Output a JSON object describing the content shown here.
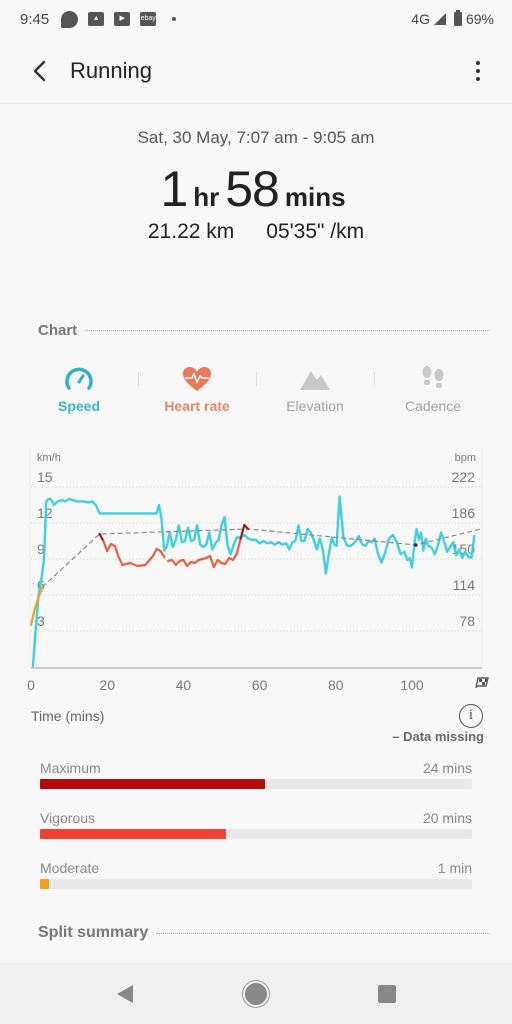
{
  "status_bar": {
    "time": "9:45",
    "notification_icons": [
      "app-notification-icon",
      "gallery-icon",
      "youtube-icon",
      "ebay-icon"
    ],
    "ebay_label": "ebay",
    "network": "4G",
    "battery": "69%"
  },
  "app_bar": {
    "title": "Running",
    "back_icon": "chevron-left-icon",
    "more_icon": "more-vertical-icon"
  },
  "summary": {
    "date_range": "Sat, 30 May, 7:07 am - 9:05 am",
    "duration_hours": "1",
    "duration_hours_unit": "hr",
    "duration_minutes": "58",
    "duration_minutes_unit": "mins",
    "distance": "21.22 km",
    "pace": "05'35\" /km"
  },
  "chart_section": {
    "title": "Chart",
    "tabs": [
      {
        "label": "Speed",
        "icon": "speedometer-icon",
        "active": true,
        "color": "#3ab5c4"
      },
      {
        "label": "Heart rate",
        "icon": "heart-rate-icon",
        "active": true,
        "color": "#e8866a"
      },
      {
        "label": "Elevation",
        "icon": "mountain-icon",
        "active": false,
        "color": "#a0a0a0"
      },
      {
        "label": "Cadence",
        "icon": "footsteps-icon",
        "active": false,
        "color": "#a0a0a0"
      }
    ]
  },
  "chart_data": {
    "type": "line",
    "title": "",
    "xlabel": "Time (mins)",
    "ylabel": "km/h",
    "y2label": "bpm",
    "xlim": [
      0,
      118
    ],
    "ylim": [
      0,
      16
    ],
    "y2lim": [
      42,
      234
    ],
    "x_ticks": [
      0,
      20,
      40,
      60,
      80,
      100
    ],
    "x_end_marker": "finish-flag-icon",
    "y_ticks": [
      3,
      6,
      9,
      12,
      15
    ],
    "y2_ticks": [
      78,
      114,
      150,
      186,
      222
    ],
    "grid": true,
    "series": [
      {
        "name": "Speed",
        "unit": "km/h",
        "color": "#3fd0dc",
        "x": [
          0.5,
          1.2,
          2,
          2.8,
          3.4,
          4,
          4.6,
          5.2,
          6,
          7,
          8,
          9,
          10,
          11,
          12,
          13,
          14,
          15,
          16,
          17,
          18,
          20,
          24,
          28,
          32,
          33,
          33.6,
          34.2,
          35,
          35.6,
          36.4,
          37.2,
          38,
          38.8,
          39.6,
          40.4,
          41.2,
          42,
          42.8,
          43.6,
          44.4,
          45.2,
          46,
          46.8,
          47.6,
          48.4,
          49.2,
          50,
          50.8,
          51.6,
          52.4,
          53.2,
          54,
          55,
          56,
          57,
          58,
          59,
          60,
          61,
          62,
          63,
          64,
          65,
          66,
          67,
          67.8,
          68.6,
          69.4,
          70.2,
          71,
          71.8,
          72.6,
          73.4,
          74.2,
          75,
          75.8,
          76.6,
          77.4,
          78.2,
          79,
          79.6,
          80.2,
          81,
          82,
          83,
          84,
          85,
          86,
          87,
          87.8,
          88.6,
          89.4,
          90.2,
          91,
          92,
          93,
          94,
          95,
          96,
          97,
          98,
          98.8,
          99.4,
          100,
          100.6,
          101.2,
          101.8,
          102.4,
          103,
          103.6,
          104.2,
          105,
          106,
          106.8,
          107.6,
          108.4,
          109.2,
          110,
          110.8,
          111.6,
          112.4,
          113.2,
          114,
          114.8,
          115.6,
          116.4,
          117.2,
          117.8
        ],
        "values": [
          0,
          3,
          6,
          7.5,
          9,
          13.8,
          14,
          14,
          13.5,
          13.8,
          13.9,
          13.8,
          14,
          13.9,
          13.8,
          13.8,
          13.8,
          13.7,
          13.8,
          13.5,
          12.8,
          12.8,
          12.8,
          12.8,
          12.8,
          12.8,
          13.5,
          12.5,
          9.7,
          10,
          11.2,
          10,
          10.6,
          11.8,
          10.4,
          10.5,
          11.6,
          10.5,
          10.6,
          11.8,
          10.2,
          10,
          10.2,
          11.2,
          9.8,
          10.3,
          10.6,
          11.8,
          12.5,
          10.1,
          9.4,
          10.2,
          10.8,
          10.8,
          11,
          10.7,
          10.6,
          10.6,
          10.3,
          10.5,
          10.3,
          10.4,
          10.2,
          10.4,
          10.2,
          10.3,
          9.8,
          10.4,
          10.5,
          11.8,
          10.5,
          10.5,
          11.5,
          11.2,
          10.6,
          9.8,
          10.7,
          9.8,
          7.8,
          9.5,
          10.8,
          10.2,
          10.1,
          14.2,
          10.8,
          10.1,
          10.1,
          10.4,
          10.9,
          10.2,
          10.1,
          10.5,
          10.4,
          10.7,
          9.5,
          8.7,
          9.6,
          10.7,
          11,
          10.4,
          9.4,
          9.6,
          8.9,
          9.1,
          8.3,
          10.2,
          11.5,
          10.6,
          11.2,
          9.7,
          10.7,
          10.1,
          10,
          9.4,
          10.1,
          11.2,
          10.5,
          9.6,
          10,
          10.4,
          9.3,
          9.8,
          9.1,
          9.6,
          9.2,
          9.1,
          11
        ],
        "value_units_note": "left axis"
      },
      {
        "name": "Heart rate",
        "unit": "bpm",
        "color_low": "#f0a030",
        "color_mid": "#e86040",
        "color_high": "#a01818",
        "segments": [
          {
            "x": [
              0,
              1,
              2,
              3
            ],
            "values": [
              84,
              100,
              112,
              122
            ]
          },
          {
            "x": [
              18,
              19,
              20,
              21,
              22,
              23,
              24,
              26,
              28,
              30,
              32,
              33,
              34,
              35
            ],
            "values": [
              175,
              168,
              158,
              165,
              163,
              152,
              144,
              146,
              143,
              144,
              153,
              160,
              158,
              152
            ]
          },
          {
            "x": [
              36,
              37,
              38,
              39,
              40,
              41,
              42,
              43,
              44,
              45,
              46,
              47,
              48,
              49,
              50,
              51,
              52,
              53,
              54,
              55,
              56,
              57
            ],
            "values": [
              148,
              149,
              144,
              148,
              149,
              143,
              147,
              146,
              149,
              150,
              151,
              153,
              142,
              149,
              146,
              145,
              151,
              149,
              155,
              170,
              184,
              180
            ]
          }
        ]
      },
      {
        "name": "Data missing",
        "style": "dashed",
        "color": "#888888",
        "x": [
          3,
          18,
          57,
          101,
          118
        ],
        "values": [
          122,
          175,
          180,
          164,
          180
        ]
      }
    ]
  },
  "hr_zones": {
    "time_label": "Time (mins)",
    "info_icon": "info-icon",
    "legend_missing": "– Data missing",
    "zones": [
      {
        "label": "Maximum",
        "value": "24 mins",
        "minutes": 24,
        "fill_fraction": 0.52,
        "color": "#b80a0a"
      },
      {
        "label": "Vigorous",
        "value": "20 mins",
        "minutes": 20,
        "fill_fraction": 0.43,
        "color": "#ee4330"
      },
      {
        "label": "Moderate",
        "value": "1 min",
        "minutes": 1,
        "fill_fraction": 0.02,
        "color": "#f0a020"
      }
    ]
  },
  "split_summary": {
    "title": "Split summary"
  },
  "nav_bar": {
    "back": "nav-back-icon",
    "home": "nav-home-icon",
    "recents": "nav-recents-icon"
  }
}
